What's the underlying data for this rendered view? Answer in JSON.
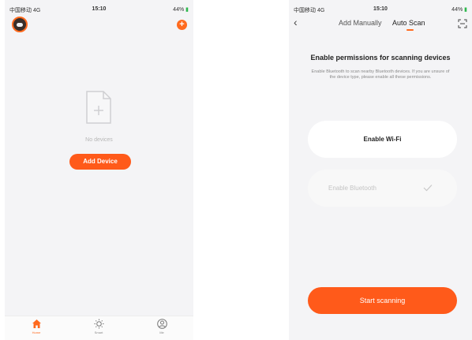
{
  "left_phone": {
    "status_bar": {
      "carrier": "中国移动 4G",
      "time": "15:10",
      "battery": "44%"
    },
    "empty_state_text": "No devices",
    "add_device_label": "Add Device",
    "tabs": [
      {
        "label": "Home",
        "icon": "home-icon",
        "active": true
      },
      {
        "label": "Smart",
        "icon": "sun-icon",
        "active": false
      },
      {
        "label": "Me",
        "icon": "user-icon",
        "active": false
      }
    ]
  },
  "right_phone": {
    "status_bar": {
      "carrier": "中国移动 4G",
      "time": "15:10",
      "battery": "44%"
    },
    "back_icon": "chevron-left-icon",
    "tabs": {
      "add_manually": "Add Manually",
      "auto_scan": "Auto Scan",
      "active": "auto_scan"
    },
    "scan_icon": "scan-frame-icon",
    "heading": "Enable permissions for scanning devices",
    "description": "Enable Bluetooth to scan nearby Bluetooth devices. If you are unsure of the device type, please enable all these permissions.",
    "permissions": {
      "wifi_label": "Enable Wi-Fi",
      "bluetooth_label": "Enable Bluetooth"
    },
    "start_label": "Start scanning"
  },
  "colors": {
    "accent": "#ff5a1a",
    "active_tab": "#ff6a1e",
    "background": "#f4f4f6",
    "battery": "#2db84d"
  }
}
